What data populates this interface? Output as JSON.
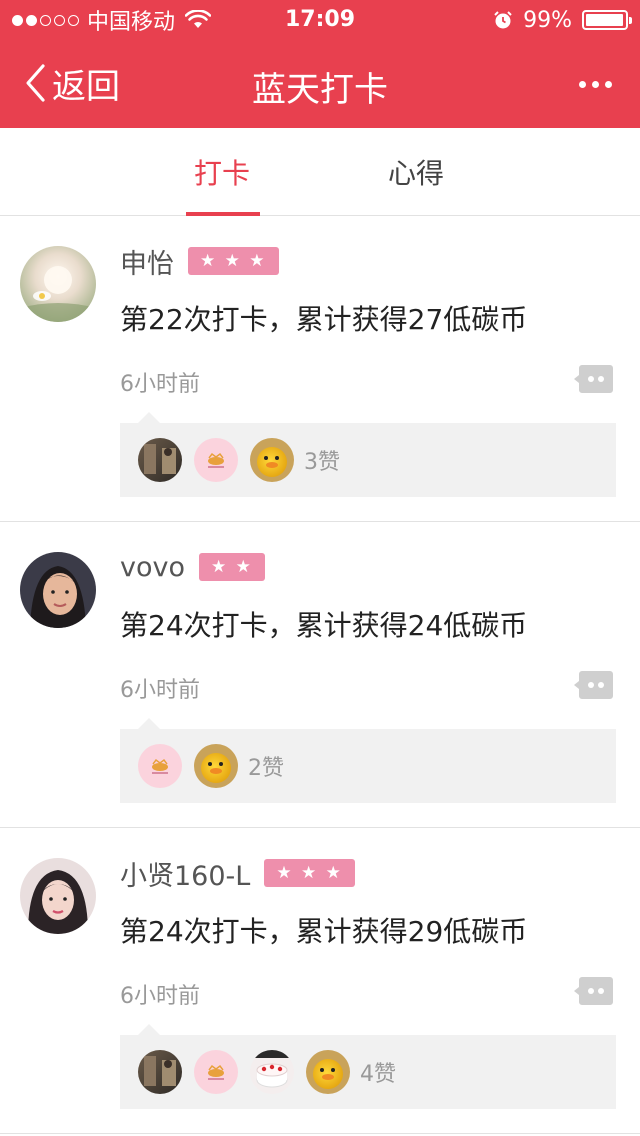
{
  "status_bar": {
    "carrier": "中国移动",
    "time": "17:09",
    "battery": "99%"
  },
  "nav": {
    "back_label": "返回",
    "title": "蓝天打卡"
  },
  "tabs": [
    {
      "label": "打卡",
      "active": true
    },
    {
      "label": "心得",
      "active": false
    }
  ],
  "colors": {
    "accent": "#e8404f",
    "badge": "#ee8fac"
  },
  "posts": [
    {
      "username": "申怡",
      "stars": "★ ★ ★",
      "message": "第22次打卡，累计获得27低碳币",
      "time": "6小时前",
      "likers": [
        "photo-avatar",
        "pink-logo-avatar",
        "duck-avatar"
      ],
      "like_count": "3赞"
    },
    {
      "username": "vovo",
      "stars": "★ ★",
      "message": "第24次打卡，累计获得24低碳币",
      "time": "6小时前",
      "likers": [
        "pink-logo-avatar",
        "duck-avatar"
      ],
      "like_count": "2赞"
    },
    {
      "username": "小贤160-L",
      "stars": "★ ★ ★",
      "message": "第24次打卡，累计获得29低碳币",
      "time": "6小时前",
      "likers": [
        "photo-avatar",
        "pink-logo-avatar",
        "cake-avatar",
        "duck-avatar"
      ],
      "like_count": "4赞"
    }
  ]
}
